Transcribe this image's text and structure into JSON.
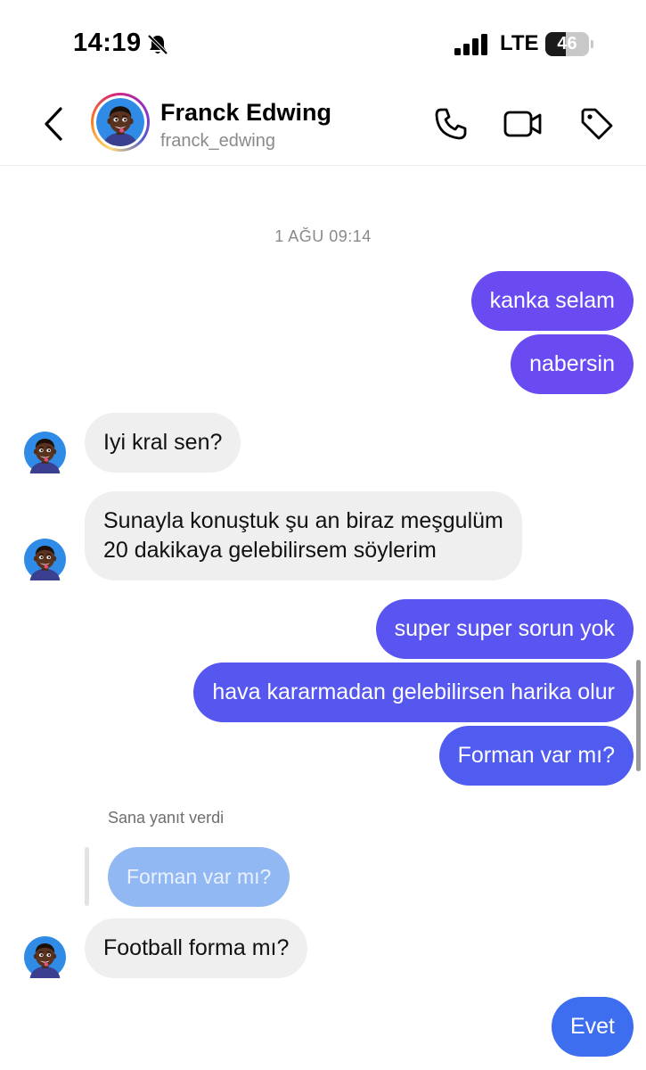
{
  "status_bar": {
    "time": "14:19",
    "network": "LTE",
    "battery_percent": "46",
    "battery_level": 0.46,
    "icons": [
      "bell-slash-icon",
      "signal-bars-icon",
      "battery-icon"
    ]
  },
  "header": {
    "name": "Franck Edwing",
    "username": "franck_edwing",
    "icons": [
      "back-chevron-icon",
      "phone-icon",
      "video-camera-icon",
      "tag-icon"
    ]
  },
  "chat": {
    "timestamp": "1 AĞU 09:14",
    "messages": [
      {
        "from": "me",
        "text": "kanka selam"
      },
      {
        "from": "me",
        "text": "nabersin"
      },
      {
        "from": "them",
        "text": "Iyi kral sen?"
      },
      {
        "from": "them",
        "lines": [
          "Sunayla konuştuk şu an biraz meşgulüm",
          "20 dakikaya gelebilirsem söylerim"
        ]
      },
      {
        "from": "me",
        "text": "super super sorun yok"
      },
      {
        "from": "me",
        "text": "hava kararmadan gelebilirsen harika olur"
      },
      {
        "from": "me",
        "text": "Forman var mı?"
      },
      {
        "from": "them",
        "reply_label": "Sana yanıt verdi",
        "quoted": "Forman var mı?",
        "text": "Football forma mı?"
      },
      {
        "from": "me",
        "text": "Evet"
      }
    ]
  },
  "colors": {
    "bubble_purple": "#6a4bf2",
    "bubble_indigo": "#5557ef",
    "bubble_blue": "#3d6ef0",
    "incoming": "#efefef",
    "quoted": "#92b8f4"
  }
}
